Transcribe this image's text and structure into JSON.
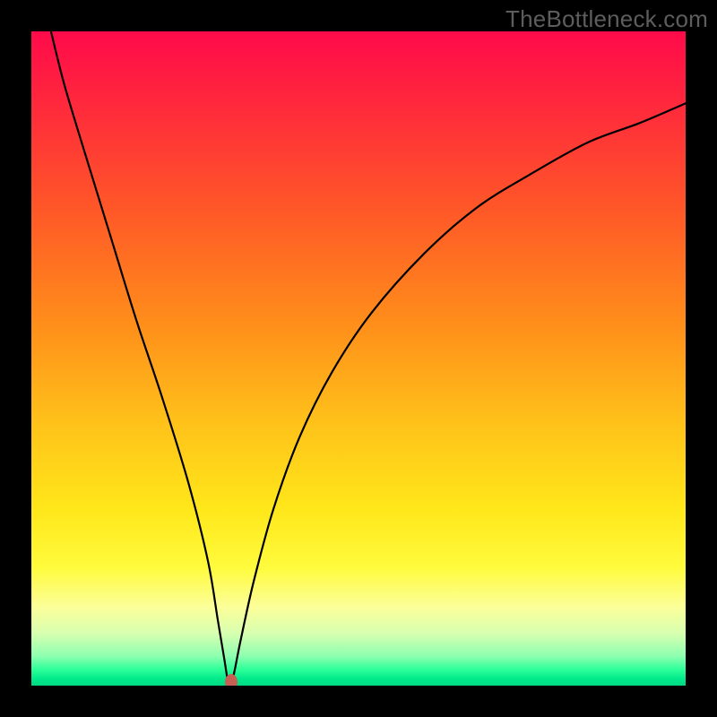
{
  "watermark": "TheBottleneck.com",
  "colors": {
    "black": "#000000",
    "curve": "#000000",
    "marker": "#c66054",
    "gradient_stops": [
      {
        "offset": 0.0,
        "color": "#ff0a4a"
      },
      {
        "offset": 0.12,
        "color": "#ff2b3b"
      },
      {
        "offset": 0.28,
        "color": "#ff5a27"
      },
      {
        "offset": 0.45,
        "color": "#ff8f1a"
      },
      {
        "offset": 0.6,
        "color": "#ffc21a"
      },
      {
        "offset": 0.73,
        "color": "#ffe71a"
      },
      {
        "offset": 0.82,
        "color": "#fffb3d"
      },
      {
        "offset": 0.88,
        "color": "#fcff9a"
      },
      {
        "offset": 0.92,
        "color": "#d8ffb0"
      },
      {
        "offset": 0.955,
        "color": "#8dffb0"
      },
      {
        "offset": 0.975,
        "color": "#2fff9a"
      },
      {
        "offset": 0.99,
        "color": "#00e98b"
      },
      {
        "offset": 1.0,
        "color": "#00da83"
      }
    ]
  },
  "chart_data": {
    "type": "line",
    "title": "",
    "xlabel": "",
    "ylabel": "",
    "xlim": [
      0,
      100
    ],
    "ylim": [
      0,
      100
    ],
    "grid": false,
    "series": [
      {
        "name": "bottleneck-curve",
        "x": [
          3,
          5,
          8,
          12,
          16,
          20,
          24,
          27,
          28.5,
          29.5,
          30,
          30.5,
          31,
          32,
          34,
          37,
          41,
          46,
          52,
          60,
          68,
          76,
          85,
          93,
          100
        ],
        "y": [
          100,
          92,
          82,
          69,
          56,
          44,
          31,
          19,
          10,
          4,
          1,
          0.5,
          2,
          7,
          16,
          27,
          38,
          48,
          57,
          66,
          73,
          78,
          83,
          86,
          89
        ]
      }
    ],
    "annotations": [
      {
        "type": "marker",
        "name": "optimal-point",
        "x": 30.5,
        "y": 0.5
      }
    ],
    "legend": false
  }
}
